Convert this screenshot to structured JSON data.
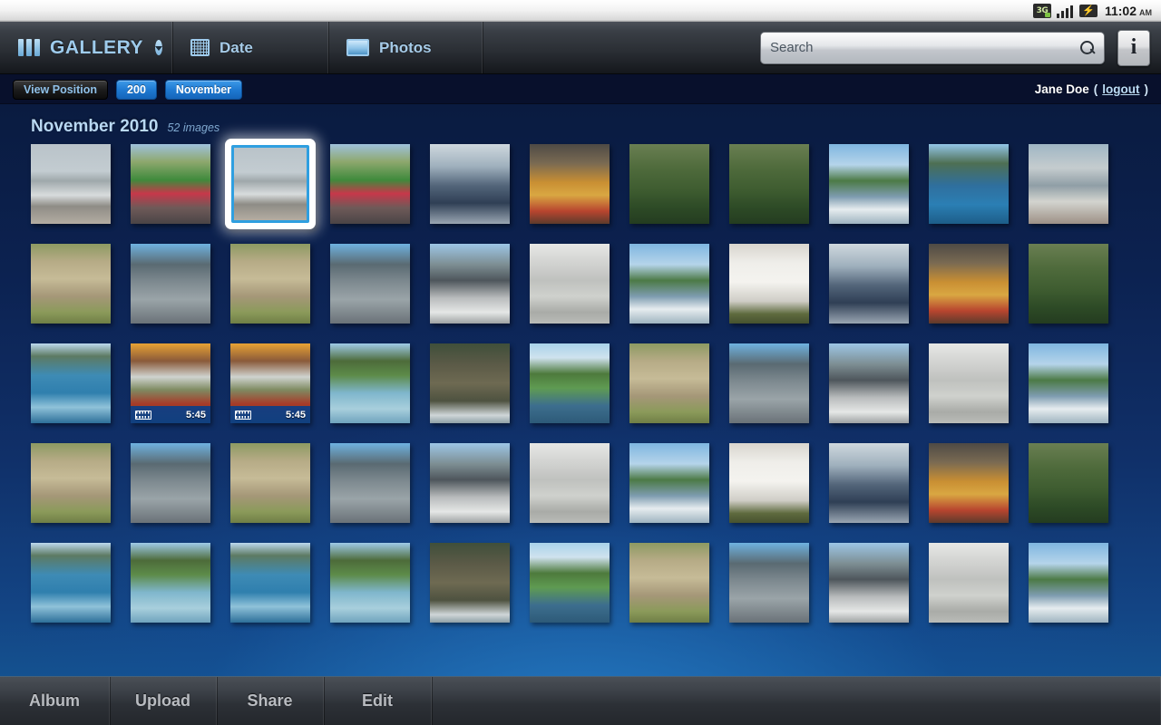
{
  "statusbar": {
    "network_icon": "3g-icon",
    "network_label": "3G",
    "signal_icon": "signal-bars-icon",
    "battery_icon": "battery-icon",
    "battery_glyph": "⚡",
    "time": "11:02",
    "ampm": "AM"
  },
  "appbar": {
    "logo_icon": "gallery-bars-icon",
    "logo_text": "GALLERY",
    "logo_caret_icon": "chevron-down-icon",
    "tabs": [
      {
        "label": "Date",
        "icon": "calendar-grid-icon"
      },
      {
        "label": "Photos",
        "icon": "photo-frame-icon"
      }
    ],
    "search": {
      "placeholder": "Search",
      "value": "",
      "icon": "search-icon"
    },
    "info_label": "i",
    "info_icon": "info-icon"
  },
  "subbar": {
    "chips": [
      {
        "label": "View Position",
        "style": "dark"
      },
      {
        "label": "200",
        "style": "blue"
      },
      {
        "label": "November",
        "style": "blue"
      }
    ],
    "user_name": "Jane Doe",
    "paren_open": "(",
    "logout_label": "logout",
    "paren_close": ")"
  },
  "main": {
    "title": "November 2010",
    "count": "52 images",
    "thumbnails": [
      {
        "name": "beach-fortress",
        "selected": false,
        "type": "photo"
      },
      {
        "name": "crowd-street",
        "selected": false,
        "type": "photo"
      },
      {
        "name": "beach-fortress-2",
        "selected": true,
        "type": "photo"
      },
      {
        "name": "crowd-street-2",
        "selected": false,
        "type": "photo"
      },
      {
        "name": "people-indoors",
        "selected": false,
        "type": "photo"
      },
      {
        "name": "guitar-player",
        "selected": false,
        "type": "photo"
      },
      {
        "name": "green-hills",
        "selected": false,
        "type": "photo"
      },
      {
        "name": "green-hills-2",
        "selected": false,
        "type": "photo"
      },
      {
        "name": "harbor-boats",
        "selected": false,
        "type": "photo"
      },
      {
        "name": "coastal-cliffs",
        "selected": false,
        "type": "photo"
      },
      {
        "name": "beach-shore",
        "selected": false,
        "type": "photo"
      },
      {
        "name": "stone-steps",
        "selected": false,
        "type": "photo"
      },
      {
        "name": "cathedral-tower",
        "selected": false,
        "type": "photo"
      },
      {
        "name": "stone-steps-2",
        "selected": false,
        "type": "photo"
      },
      {
        "name": "cathedral-tower-2",
        "selected": false,
        "type": "photo"
      },
      {
        "name": "city-crosswalk",
        "selected": false,
        "type": "photo"
      },
      {
        "name": "white-building",
        "selected": false,
        "type": "photo"
      },
      {
        "name": "harbor-boats-2",
        "selected": false,
        "type": "photo"
      },
      {
        "name": "silhouette-figures",
        "selected": false,
        "type": "photo"
      },
      {
        "name": "people-indoors-2",
        "selected": false,
        "type": "photo"
      },
      {
        "name": "guitar-player-2",
        "selected": false,
        "type": "photo"
      },
      {
        "name": "green-hills-3",
        "selected": false,
        "type": "photo"
      },
      {
        "name": "boat-wake-water",
        "selected": false,
        "type": "photo"
      },
      {
        "name": "sunset-volcano",
        "selected": false,
        "type": "video",
        "duration": "5:45"
      },
      {
        "name": "sunset-volcano-2",
        "selected": false,
        "type": "video",
        "duration": "5:45"
      },
      {
        "name": "green-bay",
        "selected": false,
        "type": "photo"
      },
      {
        "name": "rocky-coast",
        "selected": false,
        "type": "photo"
      },
      {
        "name": "river-valley",
        "selected": false,
        "type": "photo"
      },
      {
        "name": "stone-steps-3",
        "selected": false,
        "type": "photo"
      },
      {
        "name": "cathedral-tower-3",
        "selected": false,
        "type": "photo"
      },
      {
        "name": "city-crosswalk-2",
        "selected": false,
        "type": "photo"
      },
      {
        "name": "white-building-2",
        "selected": false,
        "type": "photo"
      },
      {
        "name": "harbor-boats-3",
        "selected": false,
        "type": "photo"
      },
      {
        "name": "stone-steps-4",
        "selected": false,
        "type": "photo"
      },
      {
        "name": "cathedral-tower-4",
        "selected": false,
        "type": "photo"
      },
      {
        "name": "stone-steps-5",
        "selected": false,
        "type": "photo"
      },
      {
        "name": "cathedral-tower-5",
        "selected": false,
        "type": "photo"
      },
      {
        "name": "city-crosswalk-3",
        "selected": false,
        "type": "photo"
      },
      {
        "name": "white-building-3",
        "selected": false,
        "type": "photo"
      },
      {
        "name": "harbor-boats-4",
        "selected": false,
        "type": "photo"
      },
      {
        "name": "silhouette-figures-2",
        "selected": false,
        "type": "photo"
      },
      {
        "name": "people-indoors-3",
        "selected": false,
        "type": "photo"
      },
      {
        "name": "guitar-player-3",
        "selected": false,
        "type": "photo"
      },
      {
        "name": "green-hills-4",
        "selected": false,
        "type": "photo"
      },
      {
        "name": "boat-wake-water-2",
        "selected": false,
        "type": "photo"
      },
      {
        "name": "green-bay-2",
        "selected": false,
        "type": "photo"
      },
      {
        "name": "boat-wake-water-3",
        "selected": false,
        "type": "photo"
      },
      {
        "name": "green-bay-3",
        "selected": false,
        "type": "photo"
      },
      {
        "name": "rocky-coast-2",
        "selected": false,
        "type": "photo"
      },
      {
        "name": "river-valley-2",
        "selected": false,
        "type": "photo"
      },
      {
        "name": "stone-steps-6",
        "selected": false,
        "type": "photo"
      },
      {
        "name": "cathedral-tower-6",
        "selected": false,
        "type": "photo"
      },
      {
        "name": "city-crosswalk-4",
        "selected": false,
        "type": "photo"
      },
      {
        "name": "white-building-4",
        "selected": false,
        "type": "photo"
      },
      {
        "name": "harbor-boats-5",
        "selected": false,
        "type": "photo"
      }
    ]
  },
  "bottombar": {
    "items": [
      {
        "label": "Album"
      },
      {
        "label": "Upload"
      },
      {
        "label": "Share"
      },
      {
        "label": "Edit"
      }
    ]
  },
  "colors": {
    "accent_blue": "#1f7ad2",
    "title_blue": "#b9d8f2",
    "bg_deep": "#0a1b40",
    "bg_light": "#14518f",
    "selection_white": "#ffffff",
    "selection_inner": "#2f9fe0"
  }
}
